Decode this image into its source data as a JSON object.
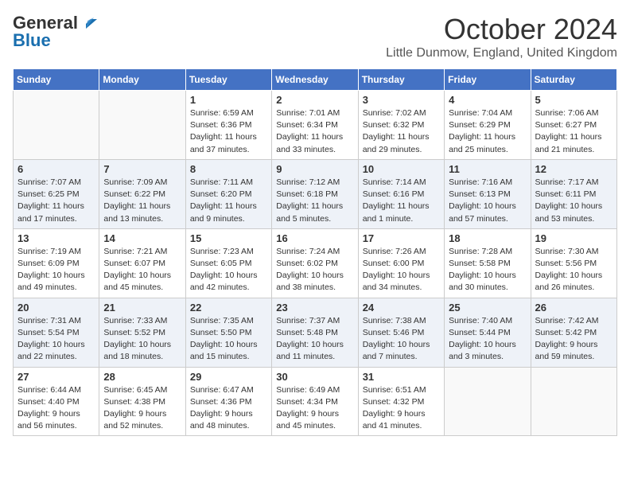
{
  "logo": {
    "line1": "General",
    "line2": "Blue"
  },
  "title": "October 2024",
  "location": "Little Dunmow, England, United Kingdom",
  "weekdays": [
    "Sunday",
    "Monday",
    "Tuesday",
    "Wednesday",
    "Thursday",
    "Friday",
    "Saturday"
  ],
  "weeks": [
    [
      {
        "day": "",
        "info": ""
      },
      {
        "day": "",
        "info": ""
      },
      {
        "day": "1",
        "info": "Sunrise: 6:59 AM\nSunset: 6:36 PM\nDaylight: 11 hours and 37 minutes."
      },
      {
        "day": "2",
        "info": "Sunrise: 7:01 AM\nSunset: 6:34 PM\nDaylight: 11 hours and 33 minutes."
      },
      {
        "day": "3",
        "info": "Sunrise: 7:02 AM\nSunset: 6:32 PM\nDaylight: 11 hours and 29 minutes."
      },
      {
        "day": "4",
        "info": "Sunrise: 7:04 AM\nSunset: 6:29 PM\nDaylight: 11 hours and 25 minutes."
      },
      {
        "day": "5",
        "info": "Sunrise: 7:06 AM\nSunset: 6:27 PM\nDaylight: 11 hours and 21 minutes."
      }
    ],
    [
      {
        "day": "6",
        "info": "Sunrise: 7:07 AM\nSunset: 6:25 PM\nDaylight: 11 hours and 17 minutes."
      },
      {
        "day": "7",
        "info": "Sunrise: 7:09 AM\nSunset: 6:22 PM\nDaylight: 11 hours and 13 minutes."
      },
      {
        "day": "8",
        "info": "Sunrise: 7:11 AM\nSunset: 6:20 PM\nDaylight: 11 hours and 9 minutes."
      },
      {
        "day": "9",
        "info": "Sunrise: 7:12 AM\nSunset: 6:18 PM\nDaylight: 11 hours and 5 minutes."
      },
      {
        "day": "10",
        "info": "Sunrise: 7:14 AM\nSunset: 6:16 PM\nDaylight: 11 hours and 1 minute."
      },
      {
        "day": "11",
        "info": "Sunrise: 7:16 AM\nSunset: 6:13 PM\nDaylight: 10 hours and 57 minutes."
      },
      {
        "day": "12",
        "info": "Sunrise: 7:17 AM\nSunset: 6:11 PM\nDaylight: 10 hours and 53 minutes."
      }
    ],
    [
      {
        "day": "13",
        "info": "Sunrise: 7:19 AM\nSunset: 6:09 PM\nDaylight: 10 hours and 49 minutes."
      },
      {
        "day": "14",
        "info": "Sunrise: 7:21 AM\nSunset: 6:07 PM\nDaylight: 10 hours and 45 minutes."
      },
      {
        "day": "15",
        "info": "Sunrise: 7:23 AM\nSunset: 6:05 PM\nDaylight: 10 hours and 42 minutes."
      },
      {
        "day": "16",
        "info": "Sunrise: 7:24 AM\nSunset: 6:02 PM\nDaylight: 10 hours and 38 minutes."
      },
      {
        "day": "17",
        "info": "Sunrise: 7:26 AM\nSunset: 6:00 PM\nDaylight: 10 hours and 34 minutes."
      },
      {
        "day": "18",
        "info": "Sunrise: 7:28 AM\nSunset: 5:58 PM\nDaylight: 10 hours and 30 minutes."
      },
      {
        "day": "19",
        "info": "Sunrise: 7:30 AM\nSunset: 5:56 PM\nDaylight: 10 hours and 26 minutes."
      }
    ],
    [
      {
        "day": "20",
        "info": "Sunrise: 7:31 AM\nSunset: 5:54 PM\nDaylight: 10 hours and 22 minutes."
      },
      {
        "day": "21",
        "info": "Sunrise: 7:33 AM\nSunset: 5:52 PM\nDaylight: 10 hours and 18 minutes."
      },
      {
        "day": "22",
        "info": "Sunrise: 7:35 AM\nSunset: 5:50 PM\nDaylight: 10 hours and 15 minutes."
      },
      {
        "day": "23",
        "info": "Sunrise: 7:37 AM\nSunset: 5:48 PM\nDaylight: 10 hours and 11 minutes."
      },
      {
        "day": "24",
        "info": "Sunrise: 7:38 AM\nSunset: 5:46 PM\nDaylight: 10 hours and 7 minutes."
      },
      {
        "day": "25",
        "info": "Sunrise: 7:40 AM\nSunset: 5:44 PM\nDaylight: 10 hours and 3 minutes."
      },
      {
        "day": "26",
        "info": "Sunrise: 7:42 AM\nSunset: 5:42 PM\nDaylight: 9 hours and 59 minutes."
      }
    ],
    [
      {
        "day": "27",
        "info": "Sunrise: 6:44 AM\nSunset: 4:40 PM\nDaylight: 9 hours and 56 minutes."
      },
      {
        "day": "28",
        "info": "Sunrise: 6:45 AM\nSunset: 4:38 PM\nDaylight: 9 hours and 52 minutes."
      },
      {
        "day": "29",
        "info": "Sunrise: 6:47 AM\nSunset: 4:36 PM\nDaylight: 9 hours and 48 minutes."
      },
      {
        "day": "30",
        "info": "Sunrise: 6:49 AM\nSunset: 4:34 PM\nDaylight: 9 hours and 45 minutes."
      },
      {
        "day": "31",
        "info": "Sunrise: 6:51 AM\nSunset: 4:32 PM\nDaylight: 9 hours and 41 minutes."
      },
      {
        "day": "",
        "info": ""
      },
      {
        "day": "",
        "info": ""
      }
    ]
  ]
}
